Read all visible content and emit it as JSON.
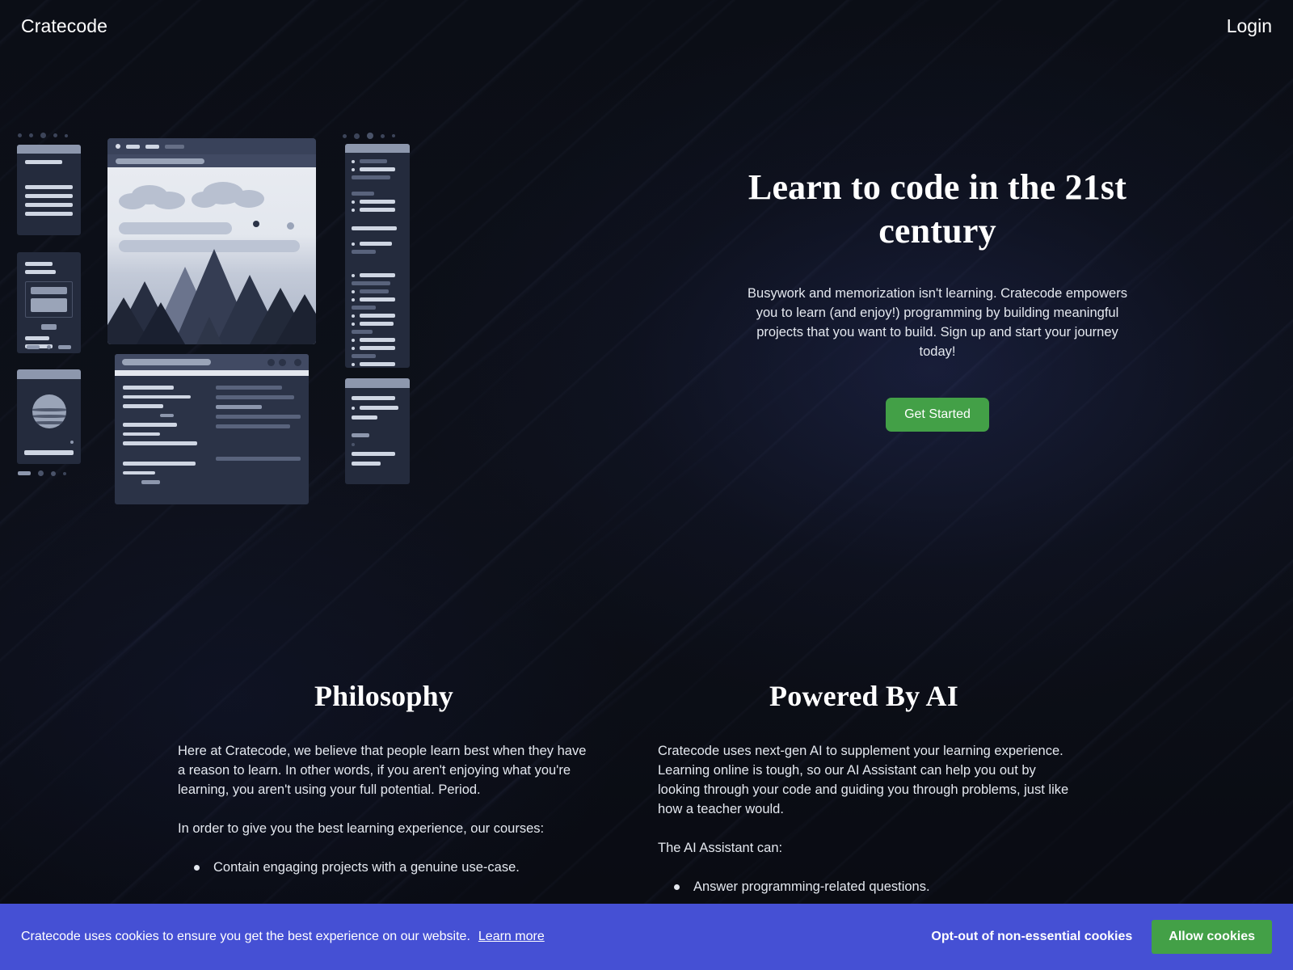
{
  "header": {
    "brand": "Cratecode",
    "login_label": "Login"
  },
  "hero": {
    "title": "Learn to code in the 21st century",
    "subtitle": "Busywork and memorization isn't learning. Cratecode empowers you to learn (and enjoy!) programming by building meaningful projects that you want to build. Sign up and start your journey today!",
    "cta_label": "Get Started",
    "cta_color": "#43a047",
    "illustration_alt": "Collage of app, browser and code-editor mockups with a mountain landscape"
  },
  "sections": [
    {
      "title": "Philosophy",
      "paragraphs": [
        "Here at Cratecode, we believe that people learn best when they have a reason to learn. In other words, if you aren't enjoying what you're learning, you aren't using your full potential. Period.",
        "In order to give you the best learning experience, our courses:"
      ],
      "bullets": [
        "Contain engaging projects with a genuine use-case."
      ]
    },
    {
      "title": "Powered By AI",
      "paragraphs": [
        "Cratecode uses next-gen AI to supplement your learning experience. Learning online is tough, so our AI Assistant can help you out by looking through your code and guiding you through problems, just like how a teacher would.",
        "The AI Assistant can:"
      ],
      "bullets": [
        "Answer programming-related questions."
      ]
    }
  ],
  "cookie_banner": {
    "message": "Cratecode uses cookies to ensure you get the best experience on our website.",
    "learn_more_label": "Learn more",
    "optout_label": "Opt-out of non-essential cookies",
    "allow_label": "Allow cookies",
    "background_color": "#4550d4",
    "allow_color": "#43a047"
  }
}
